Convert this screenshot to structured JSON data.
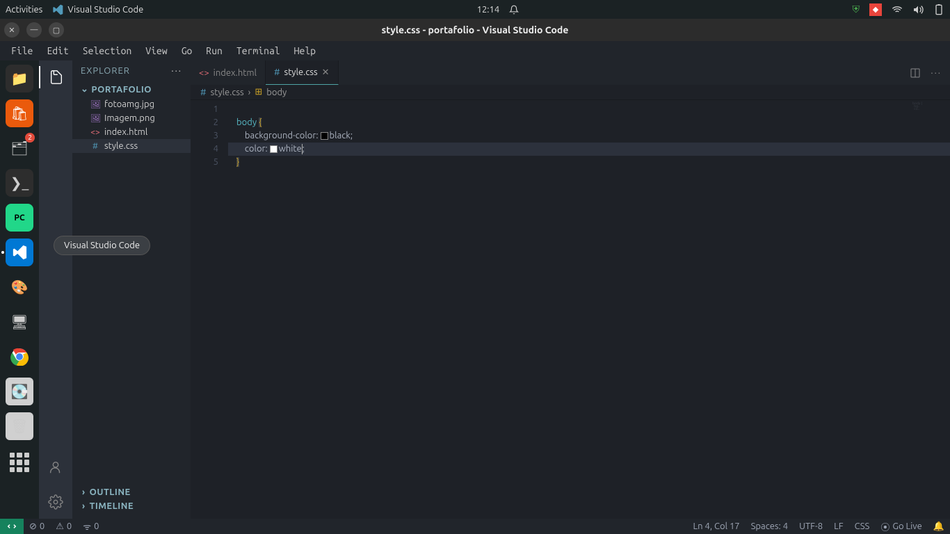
{
  "gnome": {
    "activities": "Activities",
    "app_label": "Visual Studio Code",
    "time": "12:14"
  },
  "window": {
    "title": "style.css - portafolio - Visual Studio Code"
  },
  "menu": {
    "items": [
      "File",
      "Edit",
      "Selection",
      "View",
      "Go",
      "Run",
      "Terminal",
      "Help"
    ]
  },
  "sidebar": {
    "title": "EXPLORER",
    "project": "PORTAFOLIO",
    "files": [
      {
        "icon": "🖼",
        "name": "fotoamg.jpg",
        "color": "#a074c4"
      },
      {
        "icon": "🖼",
        "name": "Imagem.png",
        "color": "#a074c4"
      },
      {
        "icon": "<>",
        "name": "index.html",
        "color": "#e06c75"
      },
      {
        "icon": "#",
        "name": "style.css",
        "color": "#519aba",
        "active": true
      }
    ],
    "outline": "OUTLINE",
    "timeline": "TIMELINE"
  },
  "tabs": [
    {
      "icon": "<>",
      "label": "index.html",
      "active": false,
      "iconColor": "#e06c75"
    },
    {
      "icon": "#",
      "label": "style.css",
      "active": true,
      "iconColor": "#519aba",
      "closable": true
    }
  ],
  "breadcrumb": {
    "file_icon": "#",
    "file": "style.css",
    "symbol_icon": "⊞",
    "symbol": "body"
  },
  "code": {
    "selector": "body",
    "lines": [
      {
        "n": 1,
        "t": "empty"
      },
      {
        "n": 2,
        "t": "open"
      },
      {
        "n": 3,
        "t": "bg",
        "prop": "background-color",
        "val": "black",
        "swatch": "#000000"
      },
      {
        "n": 4,
        "t": "color",
        "prop": "color",
        "val": "white",
        "swatch": "#ffffff",
        "hl": true,
        "cursor": true
      },
      {
        "n": 5,
        "t": "close"
      }
    ]
  },
  "status": {
    "errors": "0",
    "warnings": "0",
    "ports": "0",
    "position": "Ln 4, Col 17",
    "spaces": "Spaces: 4",
    "encoding": "UTF-8",
    "eol": "LF",
    "lang": "CSS",
    "golive": "Go Live"
  },
  "tooltip": "Visual Studio Code",
  "dock_badge": "2"
}
